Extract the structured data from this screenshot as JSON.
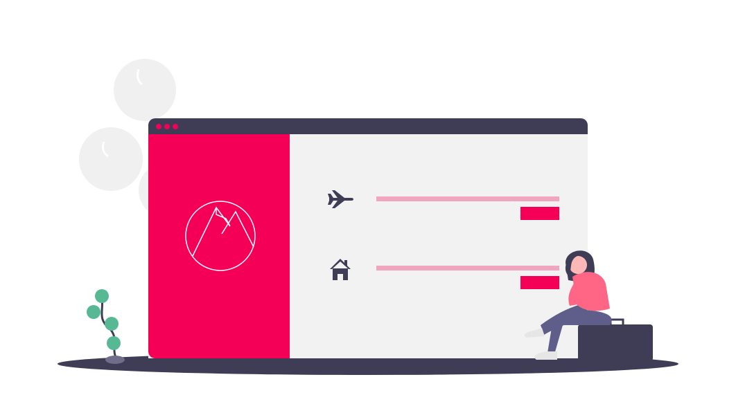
{
  "colors": {
    "accent": "#f50057",
    "dark": "#3f3d56",
    "panel": "#f2f2f2",
    "bar_light": "#f0a6bf",
    "foliage": "#f2f2f2",
    "plant": "#57b894",
    "skin": "#ffb8b8",
    "shirt": "#ff6584",
    "jeans": "#5f5d8a",
    "shoe": "#e6e6e6"
  },
  "window": {
    "dots_count": 3
  },
  "sidebar": {
    "logo_icon": "mountain-logo-icon"
  },
  "rows": [
    {
      "icon": "airplane-icon"
    },
    {
      "icon": "home-icon"
    }
  ]
}
